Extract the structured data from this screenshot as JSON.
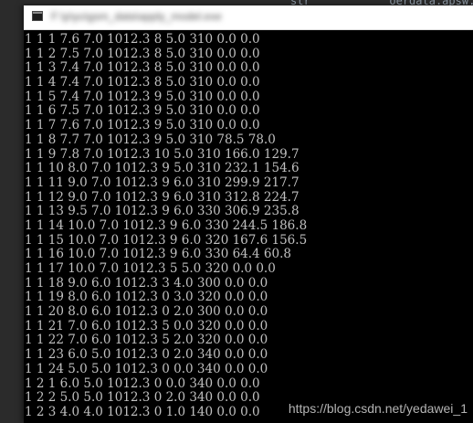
{
  "background_editor": {
    "code_fragment": "str            oerdata.apsw.back(strdata)"
  },
  "window": {
    "title": "F:\\p\\yu\\gsm_data\\apply_model.exe"
  },
  "console": {
    "lines": [
      "1 1 1 7.6 7.0 1012.3 8 5.0 310 0.0 0.0",
      "1 1 2 7.5 7.0 1012.3 8 5.0 310 0.0 0.0",
      "1 1 3 7.4 7.0 1012.3 8 5.0 310 0.0 0.0",
      "1 1 4 7.4 7.0 1012.3 8 5.0 310 0.0 0.0",
      "1 1 5 7.4 7.0 1012.3 9 5.0 310 0.0 0.0",
      "1 1 6 7.5 7.0 1012.3 9 5.0 310 0.0 0.0",
      "1 1 7 7.6 7.0 1012.3 9 5.0 310 0.0 0.0",
      "1 1 8 7.7 7.0 1012.3 9 5.0 310 78.5 78.0",
      "1 1 9 7.8 7.0 1012.3 10 5.0 310 166.0 129.7",
      "1 1 10 8.0 7.0 1012.3 9 5.0 310 232.1 154.6",
      "1 1 11 9.0 7.0 1012.3 9 6.0 310 299.9 217.7",
      "1 1 12 9.0 7.0 1012.3 9 6.0 310 312.8 224.7",
      "1 1 13 9.5 7.0 1012.3 9 6.0 330 306.9 235.8",
      "1 1 14 10.0 7.0 1012.3 9 6.0 330 244.5 186.8",
      "1 1 15 10.0 7.0 1012.3 9 6.0 320 167.6 156.5",
      "1 1 16 10.0 7.0 1012.3 9 6.0 330 64.4 60.8",
      "1 1 17 10.0 7.0 1012.3 5 5.0 320 0.0 0.0",
      "1 1 18 9.0 6.0 1012.3 3 4.0 300 0.0 0.0",
      "1 1 19 8.0 6.0 1012.3 0 3.0 320 0.0 0.0",
      "1 1 20 8.0 6.0 1012.3 0 2.0 300 0.0 0.0",
      "1 1 21 7.0 6.0 1012.3 5 0.0 320 0.0 0.0",
      "1 1 22 7.0 6.0 1012.3 5 2.0 320 0.0 0.0",
      "1 1 23 6.0 5.0 1012.3 0 2.0 340 0.0 0.0",
      "1 1 24 5.0 5.0 1012.3 0 0.0 340 0.0 0.0",
      "1 2 1 6.0 5.0 1012.3 0 0.0 340 0.0 0.0",
      "1 2 2 5.0 5.0 1012.3 0 2.0 340 0.0 0.0",
      "1 2 3 4.0 4.0 1012.3 0 1.0 140 0.0 0.0"
    ]
  },
  "watermark": {
    "text": "https://blog.csdn.net/yedawei_1"
  }
}
